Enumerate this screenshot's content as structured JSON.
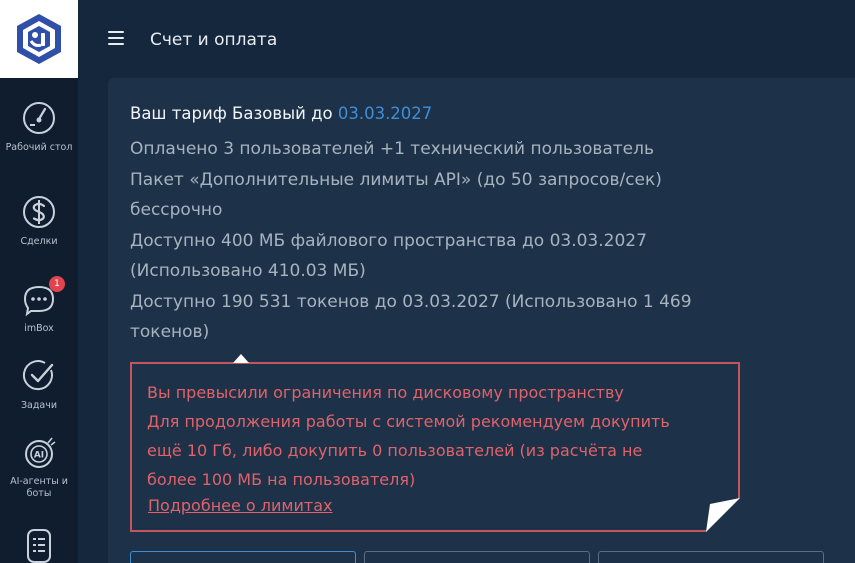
{
  "header": {
    "title": "Счет и оплата"
  },
  "sidebar": {
    "items": [
      {
        "label": "Рабочий стол",
        "icon": "dashboard-gauge-icon"
      },
      {
        "label": "Сделки",
        "icon": "dollar-icon"
      },
      {
        "label": "imBox",
        "icon": "chat-bubble-icon",
        "badge": "1"
      },
      {
        "label": "Задачи",
        "icon": "check-circle-icon"
      },
      {
        "label": "AI-агенты и боты",
        "icon": "ai-robot-icon"
      },
      {
        "label": "",
        "icon": "list-document-icon"
      }
    ]
  },
  "tariff": {
    "prefix": "Ваш тариф Базовый до ",
    "date": "03.03.2027",
    "lines": [
      "Оплачено 3 пользователей +1 технический пользователь",
      "Пакет «Дополнительные лимиты API» (до 50 запросов/сек)",
      "бессрочно",
      "Доступно 400 МБ файлового пространства до 03.03.2027",
      "(Использовано 410.03 МБ)",
      "Доступно 190 531 токенов до 03.03.2027 (Использовано 1 469",
      "токенов)"
    ]
  },
  "alert": {
    "lines": [
      "Вы превысили ограничения по дисковому пространству",
      "Для продолжения работы с системой рекомендуем докупить",
      "ещё 10 Гб, либо докупить 0 пользователей (из расчёта не",
      "более 100 МБ на пользователя)"
    ],
    "link": "Подробнее о лимитах"
  },
  "colors": {
    "accent": "#3f8ed8",
    "alert": "#e0626a",
    "badge": "#e2444f"
  }
}
